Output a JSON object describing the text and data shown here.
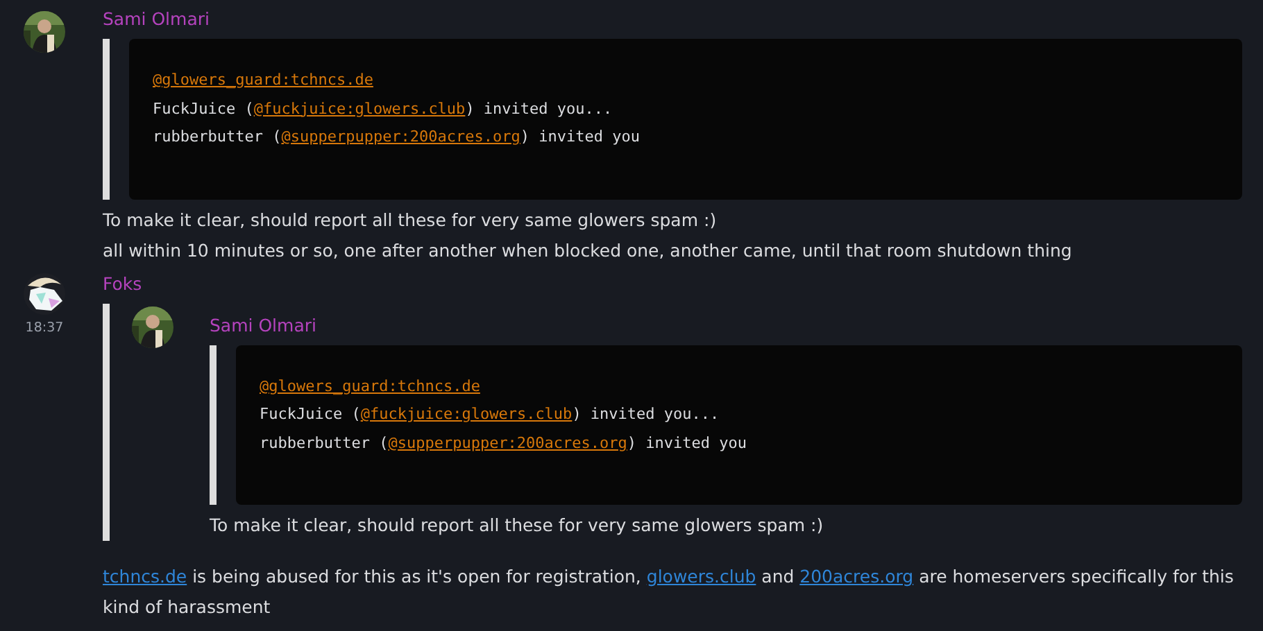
{
  "messages": [
    {
      "sender": "Sami Olmari",
      "avatar": {
        "kind": "picture"
      },
      "quote": {
        "code_lines": [
          [
            {
              "text": "@glowers_guard:tchncs.de",
              "link": true
            }
          ],
          [
            {
              "text": "FuckJuice (",
              "link": false
            },
            {
              "text": "@fuckjuice:glowers.club",
              "link": true
            },
            {
              "text": ") invited you...",
              "link": false
            }
          ],
          [
            {
              "text": "rubberbutter (",
              "link": false
            },
            {
              "text": "@supperpupper:200acres.org",
              "link": true
            },
            {
              "text": ") invited you",
              "link": false
            }
          ]
        ]
      },
      "lines": [
        [
          {
            "text": "To make it clear, should report all these for very same glowers spam :)",
            "link": false
          }
        ],
        [
          {
            "text": "all within 10 minutes or so, one after another when blocked one, another came, until that room shutdown thing",
            "link": false
          }
        ]
      ]
    },
    {
      "sender": "Foks",
      "time": "18:37",
      "avatar": {
        "kind": "picture"
      },
      "reply": {
        "sender": "Sami Olmari",
        "avatar": {
          "kind": "picture"
        },
        "quote": {
          "code_lines": [
            [
              {
                "text": "@glowers_guard:tchncs.de",
                "link": true
              }
            ],
            [
              {
                "text": "FuckJuice (",
                "link": false
              },
              {
                "text": "@fuckjuice:glowers.club",
                "link": true
              },
              {
                "text": ") invited you...",
                "link": false
              }
            ],
            [
              {
                "text": "rubberbutter (",
                "link": false
              },
              {
                "text": "@supperpupper:200acres.org",
                "link": true
              },
              {
                "text": ") invited you",
                "link": false
              }
            ]
          ]
        },
        "lines": [
          [
            {
              "text": "To make it clear, should report all these for very same glowers spam :)",
              "link": false
            }
          ]
        ]
      },
      "lines": [
        [
          {
            "text": "tchncs.de",
            "link": true
          },
          {
            "text": " is being abused for this as it's open for registration, ",
            "link": false
          },
          {
            "text": "glowers.club",
            "link": true
          },
          {
            "text": " and ",
            "link": false
          },
          {
            "text": "200acres.org",
            "link": true
          },
          {
            "text": " are homeservers specifically for this kind of harassment",
            "link": false
          }
        ]
      ]
    }
  ]
}
